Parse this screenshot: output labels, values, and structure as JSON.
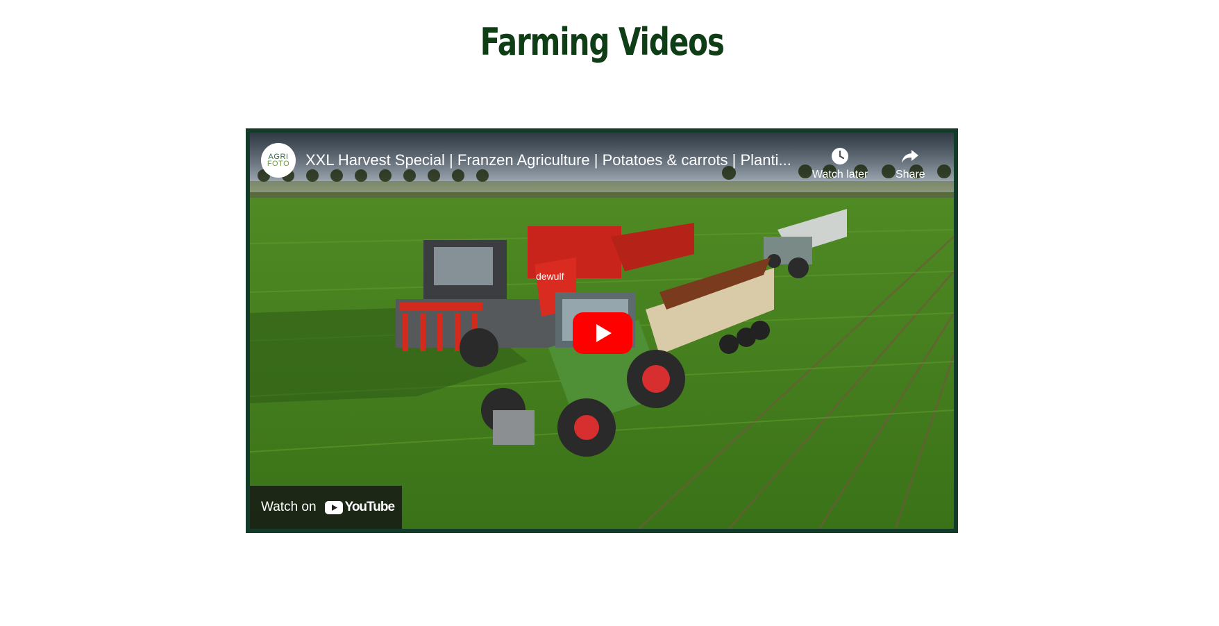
{
  "page": {
    "title": "Farming Videos"
  },
  "video": {
    "title": "XXL Harvest Special | Franzen Agriculture | Potatoes & carrots | Planti...",
    "channel_avatar_line1": "AGRI",
    "channel_avatar_line2": "FOTO",
    "watch_later_label": "Watch later",
    "share_label": "Share",
    "watch_on_label": "Watch on",
    "youtube_logo_text": "YouTube",
    "harvester_brand": "dewulf"
  },
  "colors": {
    "title": "#0f3d16",
    "frame_border": "#123b2a",
    "play_red": "#ff0000"
  }
}
